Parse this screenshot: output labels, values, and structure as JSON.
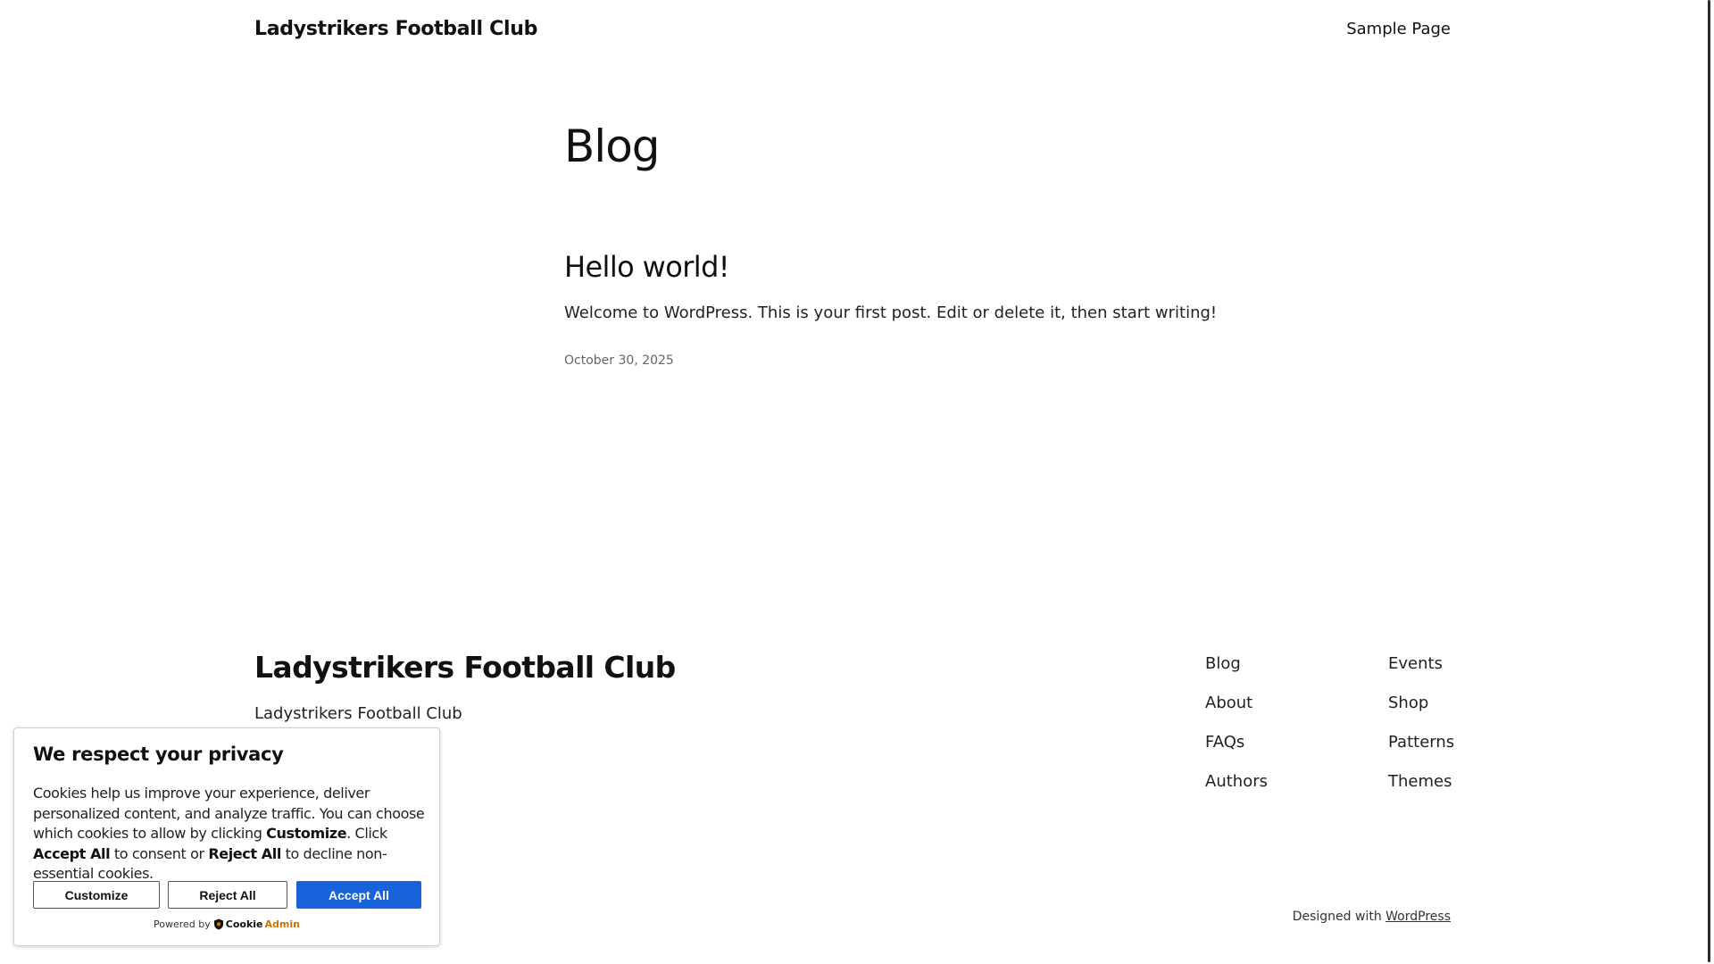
{
  "header": {
    "site_title": "Ladystrikers Football Club",
    "nav": [
      "Sample Page"
    ]
  },
  "main": {
    "page_title": "Blog",
    "posts": [
      {
        "title": "Hello world!",
        "excerpt": "Welcome to WordPress. This is your first post. Edit or delete it, then start writing!",
        "date": "October 30, 2025"
      }
    ]
  },
  "footer": {
    "site_title": "Ladystrikers Football Club",
    "tagline": "Ladystrikers Football Club",
    "links_col_1": [
      "Blog",
      "About",
      "FAQs",
      "Authors"
    ],
    "links_col_2": [
      "Events",
      "Shop",
      "Patterns",
      "Themes"
    ],
    "credit_prefix": "Designed with",
    "credit_link": "WordPress"
  },
  "cookie_banner": {
    "title": "We respect your privacy",
    "body_1": "Cookies help us improve your experience, deliver personalized content, and analyze traffic. You can choose which cookies to allow by clicking ",
    "body_customize": "Customize",
    "body_2": ". Click ",
    "body_accept": "Accept All",
    "body_3": " to consent or ",
    "body_reject": "Reject All",
    "body_4": " to decline non-essential cookies.",
    "btn_customize": "Customize",
    "btn_reject": "Reject All",
    "btn_accept": "Accept All",
    "powered_by": "Powered by",
    "brand_part_1": "Cookie",
    "brand_part_2": "Admin",
    "accent_color": "#1863dc"
  }
}
